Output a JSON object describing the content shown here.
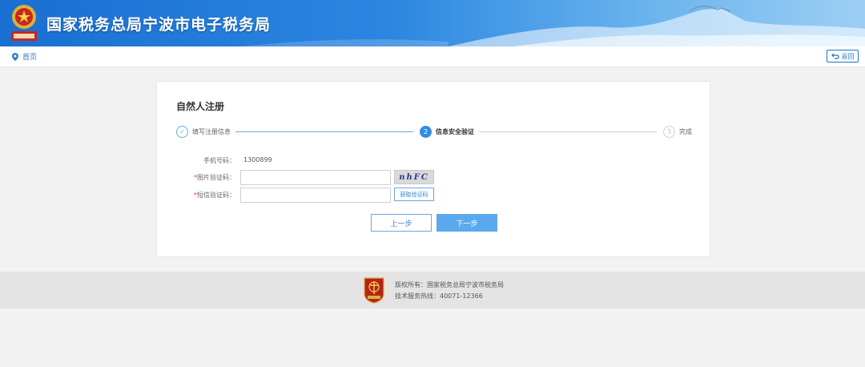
{
  "header": {
    "site_title": "国家税务总局宁波市电子税务局"
  },
  "nav": {
    "home_label": "首页",
    "back_label": "返回"
  },
  "card": {
    "title": "自然人注册"
  },
  "steps": [
    {
      "number": "✓",
      "label": "填写注册信息",
      "state": "done"
    },
    {
      "number": "2",
      "label": "信息安全验证",
      "state": "active"
    },
    {
      "number": "3",
      "label": "完成",
      "state": "todo"
    }
  ],
  "form": {
    "phone_label": "手机号码：",
    "phone_value": "1300899",
    "image_code_label": "图片验证码：",
    "image_code_value": "",
    "captcha_text": "nhFC",
    "sms_code_label": "短信验证码：",
    "sms_code_value": "",
    "sms_button_label": "获取验证码",
    "required_mark": "*"
  },
  "buttons": {
    "prev_label": "上一步",
    "next_label": "下一步"
  },
  "footer": {
    "copyright": "版权所有：国家税务总局宁波市税务局",
    "hotline": "技术服务热线：40071-12366"
  },
  "colors": {
    "primary": "#2f8ee5",
    "header_blue": "#1a6fd2",
    "next_button": "#5aa9ee"
  }
}
